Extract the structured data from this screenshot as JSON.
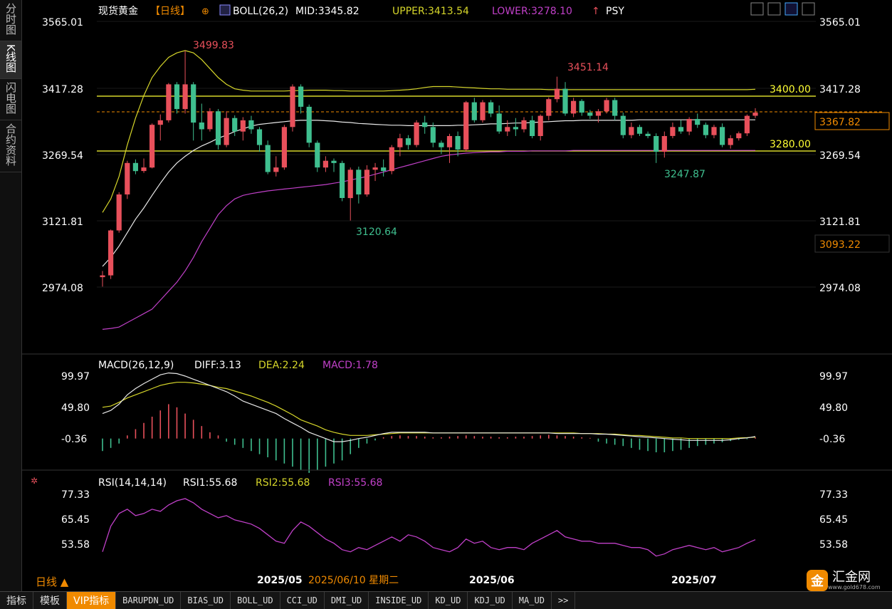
{
  "sidebar": {
    "tabs": [
      {
        "label": "分时图",
        "active": false
      },
      {
        "label": "K线图",
        "active": true
      },
      {
        "label": "闪电图",
        "active": false
      },
      {
        "label": "合约资料",
        "active": false
      }
    ]
  },
  "header": {
    "title": "现货黄金",
    "period_tag": "【日线】",
    "boll_label": "BOLL(26,2)",
    "mid_label": "MID:3345.82",
    "upper_label": "UPPER:3413.54",
    "lower_label": "LOWER:3278.10",
    "psy_label": "PSY"
  },
  "colors": {
    "up": "#e8505b",
    "down": "#3fbf8f",
    "mid": "#e8e8e8",
    "upper": "#d6d62a",
    "lower": "#c040c8",
    "price_level": "#ffff33",
    "current": "#f08a00"
  },
  "price_panel": {
    "ticks": [
      "3565.01",
      "3417.28",
      "3269.54",
      "3121.81",
      "2974.08"
    ],
    "level_lines": [
      "3400.00",
      "3280.00"
    ],
    "current_dashed": "3367.82",
    "right_boxes": [
      "3367.82",
      "3093.22"
    ],
    "annotations": [
      "3499.83",
      "3451.14",
      "3120.64",
      "3247.87"
    ]
  },
  "macd_panel": {
    "label": "MACD(26,12,9)",
    "diff_label": "DIFF:3.13",
    "dea_label": "DEA:2.24",
    "macd_label": "MACD:1.78",
    "ticks": [
      "99.97",
      "49.80",
      "-0.36"
    ]
  },
  "rsi_panel": {
    "label": "RSI(14,14,14)",
    "rsi1_label": "RSI1:55.68",
    "rsi2_label": "RSI2:55.68",
    "rsi3_label": "RSI3:55.68",
    "ticks": [
      "77.33",
      "65.45",
      "53.58"
    ]
  },
  "x_axis": {
    "labels": [
      "2025/05",
      "2025/06",
      "2025/07"
    ],
    "cursor_date": "2025/06/10 星期二"
  },
  "period_label": "日线 ▲",
  "logo": {
    "mark": "金",
    "text": "汇金网",
    "sub": "www.gold678.com"
  },
  "bottom_tabs": [
    "指标",
    "模板",
    "VIP指标",
    "BARUPDN_UD",
    "BIAS_UD",
    "BOLL_UD",
    "CCI_UD",
    "DMI_UD",
    "INSIDE_UD",
    "KD_UD",
    "KDJ_UD",
    "MA_UD",
    ">>"
  ],
  "chart_data": [
    {
      "type": "candlestick",
      "title": "现货黄金【日线】",
      "ylim": [
        2870,
        3620
      ],
      "candles": [
        [
          2996,
          3000,
          2975,
          3010
        ],
        [
          3000,
          3100,
          2992,
          3102
        ],
        [
          3100,
          3180,
          3095,
          3185
        ],
        [
          3180,
          3250,
          3170,
          3255
        ],
        [
          3250,
          3232,
          3225,
          3258
        ],
        [
          3232,
          3240,
          3228,
          3260
        ],
        [
          3240,
          3335,
          3238,
          3338
        ],
        [
          3335,
          3345,
          3300,
          3358
        ],
        [
          3345,
          3425,
          3340,
          3428
        ],
        [
          3425,
          3370,
          3360,
          3430
        ],
        [
          3370,
          3425,
          3360,
          3500
        ],
        [
          3425,
          3340,
          3300,
          3430
        ],
        [
          3340,
          3325,
          3300,
          3382
        ],
        [
          3325,
          3365,
          3320,
          3372
        ],
        [
          3365,
          3290,
          3280,
          3370
        ],
        [
          3290,
          3350,
          3285,
          3365
        ],
        [
          3350,
          3320,
          3310,
          3356
        ],
        [
          3320,
          3345,
          3300,
          3352
        ],
        [
          3345,
          3325,
          3315,
          3355
        ],
        [
          3325,
          3290,
          3275,
          3330
        ],
        [
          3290,
          3230,
          3225,
          3300
        ],
        [
          3230,
          3240,
          3220,
          3265
        ],
        [
          3240,
          3330,
          3235,
          3335
        ],
        [
          3330,
          3420,
          3320,
          3425
        ],
        [
          3420,
          3375,
          3360,
          3425
        ],
        [
          3375,
          3295,
          3285,
          3380
        ],
        [
          3295,
          3240,
          3230,
          3300
        ],
        [
          3240,
          3255,
          3230,
          3265
        ],
        [
          3255,
          3250,
          3230,
          3260
        ],
        [
          3250,
          3172,
          3165,
          3255
        ],
        [
          3172,
          3235,
          3122,
          3240
        ],
        [
          3235,
          3180,
          3160,
          3242
        ],
        [
          3180,
          3235,
          3175,
          3245
        ],
        [
          3235,
          3240,
          3210,
          3250
        ],
        [
          3240,
          3232,
          3220,
          3258
        ],
        [
          3232,
          3285,
          3225,
          3290
        ],
        [
          3285,
          3305,
          3265,
          3315
        ],
        [
          3305,
          3290,
          3280,
          3312
        ],
        [
          3290,
          3340,
          3285,
          3345
        ],
        [
          3340,
          3330,
          3315,
          3355
        ],
        [
          3330,
          3295,
          3285,
          3340
        ],
        [
          3295,
          3285,
          3270,
          3300
        ],
        [
          3285,
          3310,
          3250,
          3315
        ],
        [
          3310,
          3280,
          3265,
          3320
        ],
        [
          3280,
          3385,
          3275,
          3388
        ],
        [
          3385,
          3345,
          3340,
          3395
        ],
        [
          3345,
          3385,
          3340,
          3390
        ],
        [
          3385,
          3360,
          3352,
          3390
        ],
        [
          3360,
          3320,
          3315,
          3378
        ],
        [
          3320,
          3330,
          3310,
          3345
        ],
        [
          3330,
          3325,
          3310,
          3350
        ],
        [
          3325,
          3345,
          3318,
          3352
        ],
        [
          3345,
          3310,
          3305,
          3355
        ],
        [
          3310,
          3355,
          3300,
          3358
        ],
        [
          3355,
          3392,
          3345,
          3396
        ],
        [
          3392,
          3415,
          3385,
          3442
        ],
        [
          3415,
          3360,
          3355,
          3430
        ],
        [
          3360,
          3388,
          3352,
          3395
        ],
        [
          3388,
          3362,
          3355,
          3392
        ],
        [
          3362,
          3355,
          3348,
          3368
        ],
        [
          3355,
          3365,
          3340,
          3370
        ],
        [
          3365,
          3390,
          3360,
          3395
        ],
        [
          3390,
          3355,
          3345,
          3395
        ],
        [
          3355,
          3312,
          3305,
          3362
        ],
        [
          3312,
          3330,
          3305,
          3340
        ],
        [
          3330,
          3315,
          3310,
          3335
        ],
        [
          3315,
          3310,
          3305,
          3320
        ],
        [
          3310,
          3275,
          3250,
          3316
        ],
        [
          3275,
          3310,
          3262,
          3320
        ],
        [
          3310,
          3330,
          3305,
          3340
        ],
        [
          3330,
          3320,
          3315,
          3345
        ],
        [
          3320,
          3348,
          3312,
          3352
        ],
        [
          3348,
          3335,
          3328,
          3360
        ],
        [
          3335,
          3312,
          3305,
          3340
        ],
        [
          3312,
          3330,
          3305,
          3335
        ],
        [
          3330,
          3290,
          3285,
          3338
        ],
        [
          3290,
          3305,
          3282,
          3312
        ],
        [
          3305,
          3316,
          3300,
          3320
        ],
        [
          3316,
          3355,
          3310,
          3358
        ],
        [
          3355,
          3362,
          3350,
          3372
        ]
      ],
      "mid": [
        3020,
        3040,
        3065,
        3095,
        3125,
        3150,
        3178,
        3205,
        3230,
        3250,
        3265,
        3278,
        3288,
        3296,
        3305,
        3312,
        3320,
        3326,
        3332,
        3336,
        3338,
        3340,
        3342,
        3344,
        3345,
        3345,
        3345,
        3344,
        3343,
        3341,
        3340,
        3338,
        3337,
        3336,
        3335,
        3334,
        3334,
        3333,
        3333,
        3333,
        3333,
        3333,
        3333,
        3334,
        3334,
        3335,
        3336,
        3337,
        3337,
        3338,
        3339,
        3339,
        3340,
        3341,
        3342,
        3343,
        3344,
        3344,
        3345,
        3345,
        3345,
        3345,
        3345,
        3345,
        3345,
        3346,
        3346,
        3346,
        3346,
        3346,
        3346,
        3346,
        3346,
        3346,
        3346,
        3346,
        3346,
        3346,
        3346,
        3346
      ],
      "upper": [
        3140,
        3170,
        3220,
        3290,
        3350,
        3400,
        3440,
        3465,
        3485,
        3495,
        3500,
        3495,
        3480,
        3460,
        3440,
        3425,
        3415,
        3412,
        3410,
        3410,
        3410,
        3410,
        3410,
        3411,
        3411,
        3412,
        3412,
        3412,
        3411,
        3411,
        3410,
        3410,
        3410,
        3410,
        3410,
        3411,
        3412,
        3413,
        3415,
        3418,
        3420,
        3420,
        3420,
        3419,
        3418,
        3417,
        3416,
        3415,
        3415,
        3414,
        3414,
        3414,
        3414,
        3414,
        3413,
        3413,
        3413,
        3413,
        3413,
        3413,
        3413,
        3413,
        3413,
        3413,
        3413,
        3413,
        3413,
        3413,
        3413,
        3413,
        3413,
        3413,
        3413,
        3413,
        3413,
        3413,
        3413,
        3413,
        3413,
        3414
      ],
      "lower": [
        2880,
        2882,
        2885,
        2895,
        2905,
        2915,
        2925,
        2945,
        2965,
        2985,
        3010,
        3040,
        3075,
        3105,
        3135,
        3155,
        3170,
        3178,
        3182,
        3185,
        3188,
        3190,
        3192,
        3194,
        3196,
        3198,
        3200,
        3202,
        3205,
        3208,
        3212,
        3216,
        3220,
        3225,
        3230,
        3235,
        3240,
        3245,
        3250,
        3255,
        3260,
        3265,
        3268,
        3270,
        3272,
        3273,
        3274,
        3275,
        3275,
        3276,
        3276,
        3276,
        3277,
        3277,
        3277,
        3277,
        3277,
        3278,
        3278,
        3278,
        3278,
        3278,
        3278,
        3278,
        3278,
        3278,
        3278,
        3278,
        3278,
        3278,
        3278,
        3278,
        3278,
        3278,
        3278,
        3278,
        3278,
        3278,
        3278,
        3278
      ]
    },
    {
      "type": "line",
      "title": "MACD(26,12,9)",
      "ylim": [
        -60,
        115
      ],
      "diff": [
        40,
        45,
        55,
        70,
        80,
        88,
        95,
        102,
        105,
        104,
        100,
        95,
        90,
        85,
        80,
        75,
        68,
        60,
        55,
        50,
        45,
        40,
        32,
        25,
        18,
        10,
        5,
        0,
        -5,
        -5,
        -3,
        0,
        2,
        5,
        8,
        10,
        10,
        10,
        10,
        10,
        9,
        9,
        9,
        9,
        9,
        9,
        9,
        9,
        9,
        9,
        9,
        9,
        9,
        9,
        9,
        8,
        8,
        8,
        8,
        8,
        7,
        7,
        6,
        5,
        4,
        3,
        2,
        1,
        0,
        -1,
        -2,
        -3,
        -3,
        -3,
        -3,
        -3,
        -2,
        0,
        1,
        3.13
      ],
      "dea": [
        50,
        52,
        58,
        65,
        70,
        75,
        80,
        85,
        88,
        90,
        90,
        89,
        87,
        85,
        82,
        80,
        76,
        72,
        68,
        63,
        58,
        52,
        45,
        38,
        30,
        25,
        20,
        14,
        10,
        7,
        5,
        5,
        5,
        6,
        7,
        8,
        9,
        9,
        9,
        9,
        9,
        9,
        9,
        9,
        9,
        9,
        9,
        9,
        9,
        9,
        9,
        9,
        9,
        9,
        9,
        9,
        9,
        9,
        8,
        8,
        8,
        7,
        7,
        6,
        5,
        5,
        4,
        3,
        2,
        1,
        1,
        0,
        0,
        0,
        0,
        0,
        0,
        1,
        1.5,
        2.24
      ],
      "hist": [
        -20,
        -15,
        -8,
        5,
        15,
        25,
        35,
        45,
        55,
        50,
        40,
        30,
        20,
        10,
        5,
        -5,
        -10,
        -15,
        -20,
        -25,
        -30,
        -35,
        -40,
        -45,
        -50,
        -55,
        -50,
        -45,
        -40,
        -35,
        -25,
        -15,
        -8,
        -3,
        2,
        4,
        5,
        4,
        4,
        3,
        2,
        2,
        3,
        4,
        5,
        4,
        3,
        3,
        2,
        2,
        3,
        3,
        4,
        5,
        6,
        5,
        4,
        3,
        2,
        1,
        -5,
        -8,
        -10,
        -12,
        -15,
        -18,
        -20,
        -22,
        -22,
        -20,
        -18,
        -15,
        -12,
        -10,
        -8,
        -6,
        -4,
        -2,
        -1,
        1.78
      ]
    },
    {
      "type": "line",
      "title": "RSI(14,14,14)",
      "ylim": [
        45,
        80
      ],
      "values": [
        50,
        62,
        68,
        70,
        67,
        68,
        70,
        69,
        72,
        74,
        75,
        73,
        70,
        68,
        66,
        67,
        65,
        64,
        63,
        61,
        58,
        55,
        54,
        60,
        64,
        62,
        59,
        56,
        54,
        51,
        50,
        52,
        51,
        53,
        55,
        57,
        55,
        58,
        57,
        55,
        52,
        51,
        50,
        52,
        56,
        54,
        55,
        52,
        51,
        52,
        52,
        51,
        54,
        56,
        58,
        60,
        57,
        56,
        55,
        55,
        54,
        54,
        54,
        53,
        52,
        52,
        51,
        48,
        49,
        51,
        52,
        53,
        52,
        51,
        52,
        50,
        51,
        52,
        54,
        55.68
      ]
    }
  ]
}
